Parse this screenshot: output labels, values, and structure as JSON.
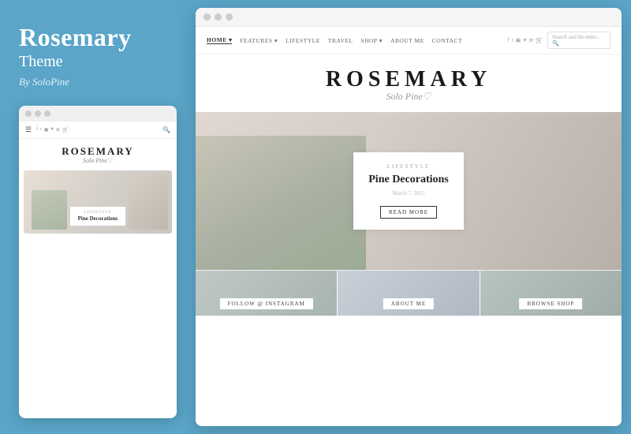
{
  "left": {
    "title": "Rosemary",
    "subtitle": "Theme",
    "byline": "By SoloPine",
    "mini_browser": {
      "dots": [
        "dot1",
        "dot2",
        "dot3"
      ],
      "nav_items": [
        "☰",
        "f",
        "t",
        "♥",
        "✉",
        "★"
      ],
      "logo_text": "ROSEMARY",
      "logo_sub": "Solo Pine♡",
      "hero_category": "LIFESTYLE",
      "hero_title": "Pine Decorations"
    }
  },
  "main_browser": {
    "dots": [
      "dot1",
      "dot2",
      "dot3"
    ],
    "nav": {
      "items": [
        "HOME",
        "FEATURES",
        "LIFESTYLE",
        "TRAVEL",
        "SHOP",
        "ABOUT ME",
        "CONTACT"
      ],
      "search_placeholder": "Search and hit enter...",
      "active": "HOME"
    },
    "logo_text": "ROSEMARY",
    "logo_sub": "Solo Pine♡",
    "hero": {
      "category": "LIFESTYLE",
      "title": "Pine Decorations",
      "date": "March 7, 2015",
      "btn_label": "READ MORE"
    },
    "bottom_tiles": [
      {
        "label": "FOLLOW @ INSTAGRAM"
      },
      {
        "label": "ABOUT ME"
      },
      {
        "label": "BROWSE SHOP"
      }
    ]
  }
}
